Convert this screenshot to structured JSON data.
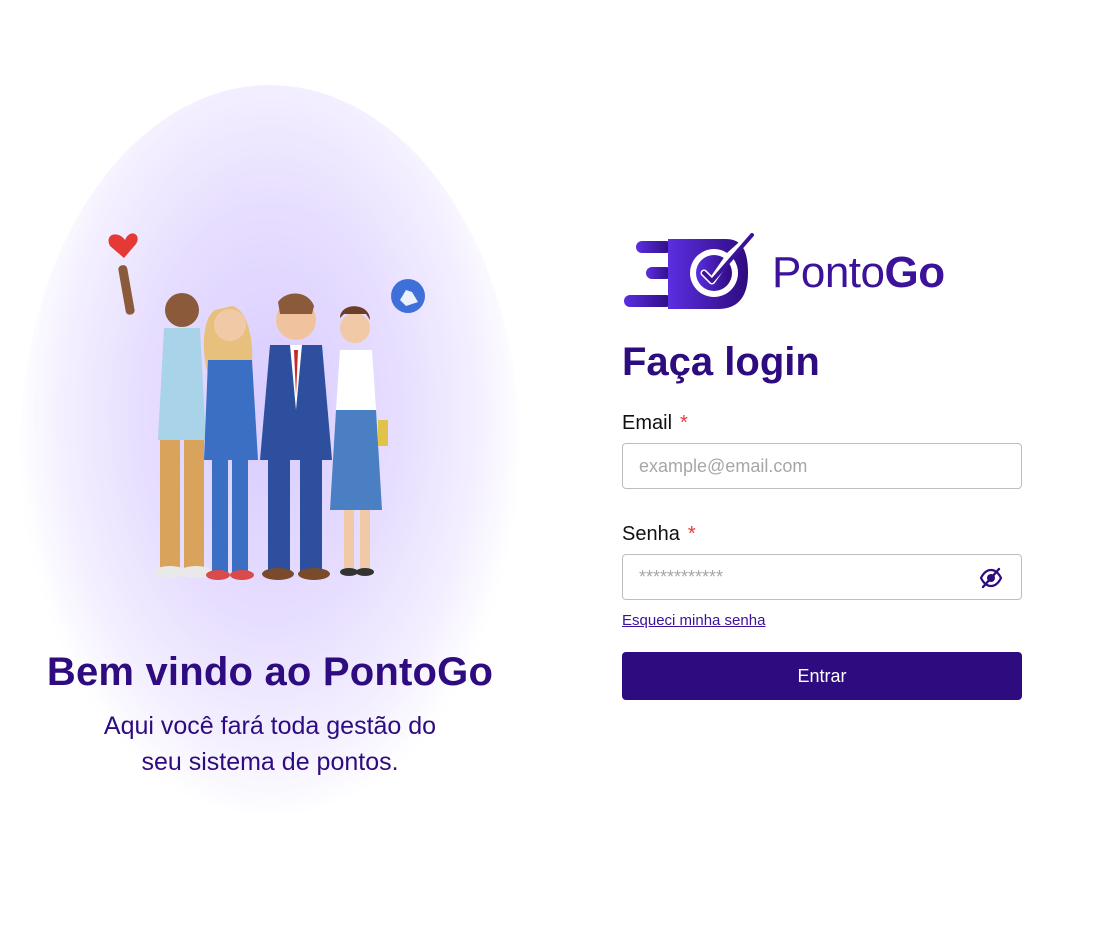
{
  "welcome": {
    "title": "Bem vindo ao PontoGo",
    "subtitle_line1": "Aqui você fará toda gestão do",
    "subtitle_line2": "seu sistema de pontos."
  },
  "brand": {
    "name_light": "Ponto",
    "name_bold": "Go",
    "primary_color": "#2e0b7f",
    "accent_color": "#5b2ee0"
  },
  "login": {
    "title": "Faça login",
    "email_label": "Email",
    "email_placeholder": "example@email.com",
    "password_label": "Senha",
    "password_placeholder": "************",
    "required_mark": "*",
    "forgot_link": "Esqueci minha senha",
    "submit_label": "Entrar",
    "password_toggle_icon": "eye-off-icon"
  }
}
